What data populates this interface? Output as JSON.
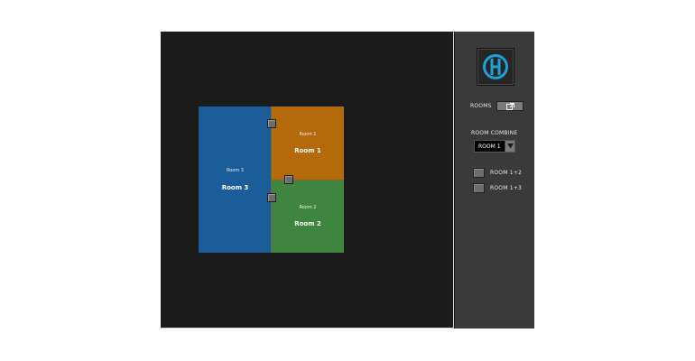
{
  "rooms": {
    "room3": {
      "small_label": "Room 3",
      "name": "Room 3",
      "color": "#1b5d99"
    },
    "room1": {
      "small_label": "Room 1",
      "name": "Room 1",
      "color": "#b46a0b"
    },
    "room2": {
      "small_label": "Room 2",
      "name": "Room 2",
      "color": "#3f8540"
    }
  },
  "side_panel": {
    "rooms_label": "ROOMS",
    "room_combine_label": "ROOM COMBINE",
    "room_combine_selected": "ROOM 1",
    "combos": [
      {
        "label": "ROOM 1+2"
      },
      {
        "label": "ROOM 1+3"
      }
    ]
  },
  "icons": {
    "logo": "logo-icon",
    "external_link": "external-link-icon",
    "dropdown": "chevron-down-icon"
  },
  "colors": {
    "accent": "#1ea0d8",
    "panel": "#3a3a3a",
    "canvas": "#1b1b1b"
  }
}
